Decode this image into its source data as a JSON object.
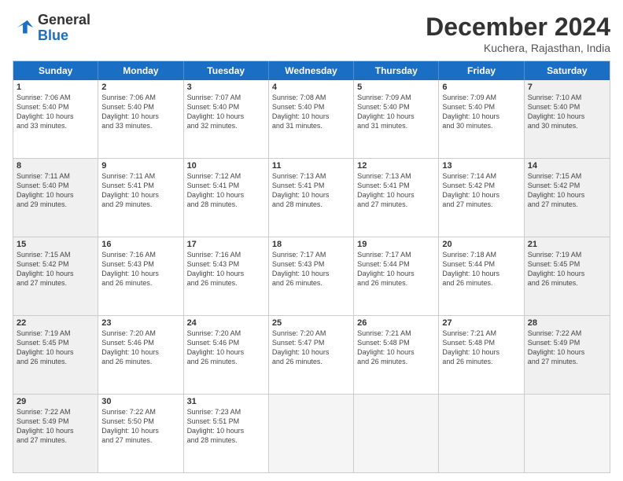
{
  "logo": {
    "line1": "General",
    "line2": "Blue"
  },
  "title": "December 2024",
  "location": "Kuchera, Rajasthan, India",
  "days_of_week": [
    "Sunday",
    "Monday",
    "Tuesday",
    "Wednesday",
    "Thursday",
    "Friday",
    "Saturday"
  ],
  "weeks": [
    [
      {
        "num": "1",
        "info": "Sunrise: 7:06 AM\nSunset: 5:40 PM\nDaylight: 10 hours\nand 33 minutes.",
        "shaded": false
      },
      {
        "num": "2",
        "info": "Sunrise: 7:06 AM\nSunset: 5:40 PM\nDaylight: 10 hours\nand 33 minutes.",
        "shaded": false
      },
      {
        "num": "3",
        "info": "Sunrise: 7:07 AM\nSunset: 5:40 PM\nDaylight: 10 hours\nand 32 minutes.",
        "shaded": false
      },
      {
        "num": "4",
        "info": "Sunrise: 7:08 AM\nSunset: 5:40 PM\nDaylight: 10 hours\nand 31 minutes.",
        "shaded": false
      },
      {
        "num": "5",
        "info": "Sunrise: 7:09 AM\nSunset: 5:40 PM\nDaylight: 10 hours\nand 31 minutes.",
        "shaded": false
      },
      {
        "num": "6",
        "info": "Sunrise: 7:09 AM\nSunset: 5:40 PM\nDaylight: 10 hours\nand 30 minutes.",
        "shaded": false
      },
      {
        "num": "7",
        "info": "Sunrise: 7:10 AM\nSunset: 5:40 PM\nDaylight: 10 hours\nand 30 minutes.",
        "shaded": true
      }
    ],
    [
      {
        "num": "8",
        "info": "Sunrise: 7:11 AM\nSunset: 5:40 PM\nDaylight: 10 hours\nand 29 minutes.",
        "shaded": true
      },
      {
        "num": "9",
        "info": "Sunrise: 7:11 AM\nSunset: 5:41 PM\nDaylight: 10 hours\nand 29 minutes.",
        "shaded": false
      },
      {
        "num": "10",
        "info": "Sunrise: 7:12 AM\nSunset: 5:41 PM\nDaylight: 10 hours\nand 28 minutes.",
        "shaded": false
      },
      {
        "num": "11",
        "info": "Sunrise: 7:13 AM\nSunset: 5:41 PM\nDaylight: 10 hours\nand 28 minutes.",
        "shaded": false
      },
      {
        "num": "12",
        "info": "Sunrise: 7:13 AM\nSunset: 5:41 PM\nDaylight: 10 hours\nand 27 minutes.",
        "shaded": false
      },
      {
        "num": "13",
        "info": "Sunrise: 7:14 AM\nSunset: 5:42 PM\nDaylight: 10 hours\nand 27 minutes.",
        "shaded": false
      },
      {
        "num": "14",
        "info": "Sunrise: 7:15 AM\nSunset: 5:42 PM\nDaylight: 10 hours\nand 27 minutes.",
        "shaded": true
      }
    ],
    [
      {
        "num": "15",
        "info": "Sunrise: 7:15 AM\nSunset: 5:42 PM\nDaylight: 10 hours\nand 27 minutes.",
        "shaded": true
      },
      {
        "num": "16",
        "info": "Sunrise: 7:16 AM\nSunset: 5:43 PM\nDaylight: 10 hours\nand 26 minutes.",
        "shaded": false
      },
      {
        "num": "17",
        "info": "Sunrise: 7:16 AM\nSunset: 5:43 PM\nDaylight: 10 hours\nand 26 minutes.",
        "shaded": false
      },
      {
        "num": "18",
        "info": "Sunrise: 7:17 AM\nSunset: 5:43 PM\nDaylight: 10 hours\nand 26 minutes.",
        "shaded": false
      },
      {
        "num": "19",
        "info": "Sunrise: 7:17 AM\nSunset: 5:44 PM\nDaylight: 10 hours\nand 26 minutes.",
        "shaded": false
      },
      {
        "num": "20",
        "info": "Sunrise: 7:18 AM\nSunset: 5:44 PM\nDaylight: 10 hours\nand 26 minutes.",
        "shaded": false
      },
      {
        "num": "21",
        "info": "Sunrise: 7:19 AM\nSunset: 5:45 PM\nDaylight: 10 hours\nand 26 minutes.",
        "shaded": true
      }
    ],
    [
      {
        "num": "22",
        "info": "Sunrise: 7:19 AM\nSunset: 5:45 PM\nDaylight: 10 hours\nand 26 minutes.",
        "shaded": true
      },
      {
        "num": "23",
        "info": "Sunrise: 7:20 AM\nSunset: 5:46 PM\nDaylight: 10 hours\nand 26 minutes.",
        "shaded": false
      },
      {
        "num": "24",
        "info": "Sunrise: 7:20 AM\nSunset: 5:46 PM\nDaylight: 10 hours\nand 26 minutes.",
        "shaded": false
      },
      {
        "num": "25",
        "info": "Sunrise: 7:20 AM\nSunset: 5:47 PM\nDaylight: 10 hours\nand 26 minutes.",
        "shaded": false
      },
      {
        "num": "26",
        "info": "Sunrise: 7:21 AM\nSunset: 5:48 PM\nDaylight: 10 hours\nand 26 minutes.",
        "shaded": false
      },
      {
        "num": "27",
        "info": "Sunrise: 7:21 AM\nSunset: 5:48 PM\nDaylight: 10 hours\nand 26 minutes.",
        "shaded": false
      },
      {
        "num": "28",
        "info": "Sunrise: 7:22 AM\nSunset: 5:49 PM\nDaylight: 10 hours\nand 27 minutes.",
        "shaded": true
      }
    ],
    [
      {
        "num": "29",
        "info": "Sunrise: 7:22 AM\nSunset: 5:49 PM\nDaylight: 10 hours\nand 27 minutes.",
        "shaded": true
      },
      {
        "num": "30",
        "info": "Sunrise: 7:22 AM\nSunset: 5:50 PM\nDaylight: 10 hours\nand 27 minutes.",
        "shaded": false
      },
      {
        "num": "31",
        "info": "Sunrise: 7:23 AM\nSunset: 5:51 PM\nDaylight: 10 hours\nand 28 minutes.",
        "shaded": false
      },
      {
        "num": "",
        "info": "",
        "shaded": false,
        "empty": true
      },
      {
        "num": "",
        "info": "",
        "shaded": false,
        "empty": true
      },
      {
        "num": "",
        "info": "",
        "shaded": false,
        "empty": true
      },
      {
        "num": "",
        "info": "",
        "shaded": false,
        "empty": true
      }
    ]
  ]
}
